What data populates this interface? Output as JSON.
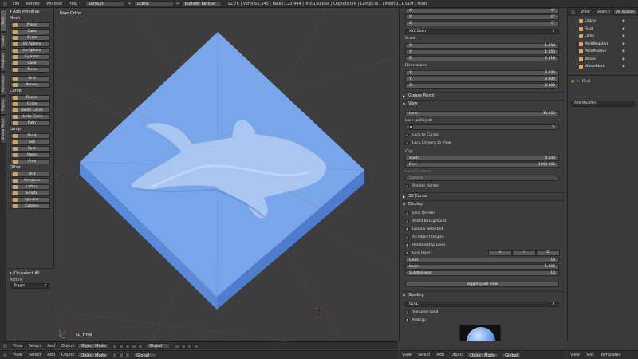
{
  "topbar": {
    "menus": [
      "File",
      "Render",
      "Window",
      "Help"
    ],
    "layout": "Default",
    "scene": "Scene",
    "engine": "Blender Render",
    "stats": "v2.76 | Verts:65,340 | Faces:125,444 | Tris:130,868 | Objects:0/6 | Lamps:0/1 | Mem:111.51M | Final"
  },
  "vtabs": [
    "Tools",
    "Create",
    "Relations",
    "Animation",
    "Physics",
    "Grease Pencil"
  ],
  "toolshelf": {
    "title": "Add Primitive",
    "sections": [
      {
        "name": "Mesh",
        "items": [
          "Plane",
          "Cube",
          "Circle",
          "UV Sphere",
          "Ico Sphere",
          "Cylinder",
          "Cone",
          "Torus",
          "Grid",
          "Monkey"
        ]
      },
      {
        "name": "Curve",
        "items": [
          "Bezier",
          "Circle",
          "Nurbs Curve",
          "Nurbs Circle",
          "Path"
        ]
      },
      {
        "name": "Lamp",
        "items": [
          "Point",
          "Sun",
          "Spot",
          "Hemi",
          "Area"
        ]
      },
      {
        "name": "Other",
        "items": [
          "Text",
          "Armature",
          "Lattice",
          "Empty",
          "Speaker",
          "Camera"
        ]
      }
    ],
    "operator_title": "(De)select All",
    "action_label": "Action",
    "action_value": "Toggle"
  },
  "viewport": {
    "view_label": "User Ortho",
    "object_label": "(1) Final"
  },
  "props": {
    "rotation": [
      {
        "axis": "X:",
        "value": "0°"
      },
      {
        "axis": "Y:",
        "value": "0°"
      },
      {
        "axis": "Z:",
        "value": "0°"
      }
    ],
    "rotation_mode": "XYZ Euler",
    "scale_label": "Scale:",
    "scale": [
      {
        "axis": "X:",
        "value": "1.650"
      },
      {
        "axis": "Y:",
        "value": "1.650"
      },
      {
        "axis": "Z:",
        "value": "2.318"
      }
    ],
    "dimensions_label": "Dimensions:",
    "dimensions": [
      {
        "axis": "X:",
        "value": "3.300"
      },
      {
        "axis": "Y:",
        "value": "3.300"
      },
      {
        "axis": "Z:",
        "value": "0.800"
      }
    ],
    "grease_pencil": "Grease Pencil",
    "view_head": "View",
    "lens_label": "Lens:",
    "lens_value": "35.000",
    "lock_to_object": "Lock to Object:",
    "lock_to_cursor": "Lock to Cursor",
    "lock_camera": "Lock Camera to View",
    "clip_label": "Clip:",
    "clip_start_label": "Start:",
    "clip_start": "0.100",
    "clip_end_label": "End:",
    "clip_end": "1000.000",
    "local_camera": "Local Camera:",
    "camera_placeholder": "Camera",
    "render_border": "Render Border",
    "cursor_3d": "3D Cursor",
    "display_head": "Display",
    "only_render": "Only Render",
    "world_bg": "World Background",
    "outline_selected": "Outline Selected",
    "all_origins": "All Object Origins",
    "relationship_lines": "Relationship Lines",
    "grid_floor": "Grid Floor",
    "axes": [
      "X",
      "Y",
      "Z"
    ],
    "lines_label": "Lines:",
    "lines_value": "16",
    "scale_f_label": "Scale:",
    "scale_f_value": "1.000",
    "subdiv_label": "Subdivisions:",
    "subdiv_value": "10",
    "toggle_quad": "Toggle Quad View",
    "shading_head": "Shading",
    "shading_mode": "GLSL",
    "textured_solid": "Textured Solid",
    "matcap": "Matcap"
  },
  "outliner": {
    "menus": [
      "View",
      "Search",
      "All Scenes"
    ],
    "items": [
      "Empty",
      "Final",
      "Lamp",
      "MoldNegative",
      "MoldPositive",
      "Whale",
      "WhaleBlock"
    ],
    "active_object": "Final",
    "add_modifier": "Add Modifier"
  },
  "bottombar": {
    "menus": [
      "View",
      "Select",
      "Add",
      "Object"
    ],
    "mode": "Object Mode",
    "pivot": "Global",
    "right_menus": [
      "View",
      "Text",
      "Templates"
    ]
  },
  "colors": {
    "object_blue": "#7aa7e8",
    "object_side": "#5c8bd6",
    "viewport_bg": "#3d3d3d",
    "selected_orange": "#e4a25a"
  }
}
